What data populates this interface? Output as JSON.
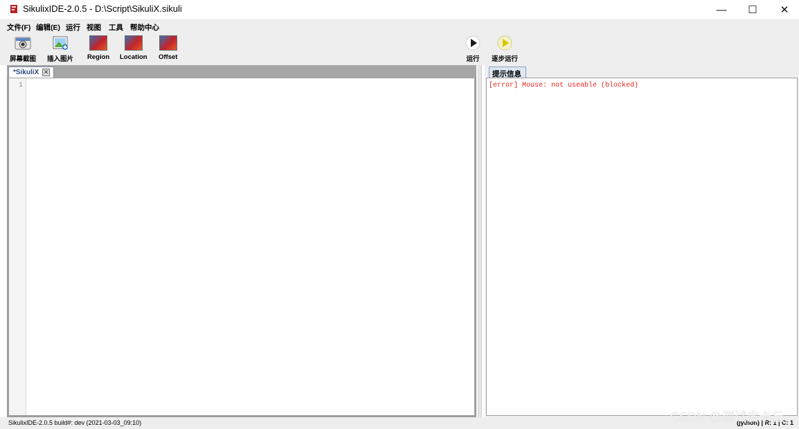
{
  "window": {
    "title": "SikulixIDE-2.0.5 - D:\\Script\\SikuliX.sikuli",
    "icon": "sikulix-app-icon",
    "controls": {
      "minimize": "—",
      "maximize": "☐",
      "close": "✕"
    }
  },
  "menu": [
    {
      "label": "文件(F)"
    },
    {
      "label": "编辑(E)"
    },
    {
      "label": "运行"
    },
    {
      "label": "视图"
    },
    {
      "label": "工具"
    },
    {
      "label": "帮助中心"
    }
  ],
  "toolbar": {
    "capture": {
      "label": "屏幕截图",
      "icon": "camera-icon"
    },
    "insert_image": {
      "label": "插入图片",
      "icon": "insert-image-icon"
    },
    "region": {
      "label": "Region",
      "icon": "region-icon"
    },
    "location": {
      "label": "Location",
      "icon": "location-icon"
    },
    "offset": {
      "label": "Offset",
      "icon": "offset-icon"
    },
    "run": {
      "label": "运行",
      "icon": "play-icon",
      "color": "#1a1a1a"
    },
    "step_run": {
      "label": "逐步运行",
      "icon": "step-play-icon",
      "color": "#d7c400"
    }
  },
  "editor": {
    "tab_label": "*SikuliX",
    "close_glyph": "✕",
    "line_numbers": [
      "1"
    ],
    "content": ""
  },
  "messages": {
    "tab_label": "提示信息",
    "lines": [
      "[error] Mouse: not useable (blocked)"
    ],
    "error_color": "#e8261f"
  },
  "status": {
    "left": "SikulixIDE-2.0.5 build#: dev (2021-03-03_09:10)",
    "right": "(jython) | R: 1 | C: 1"
  },
  "watermark": "CSDN @测试皮卡丘"
}
